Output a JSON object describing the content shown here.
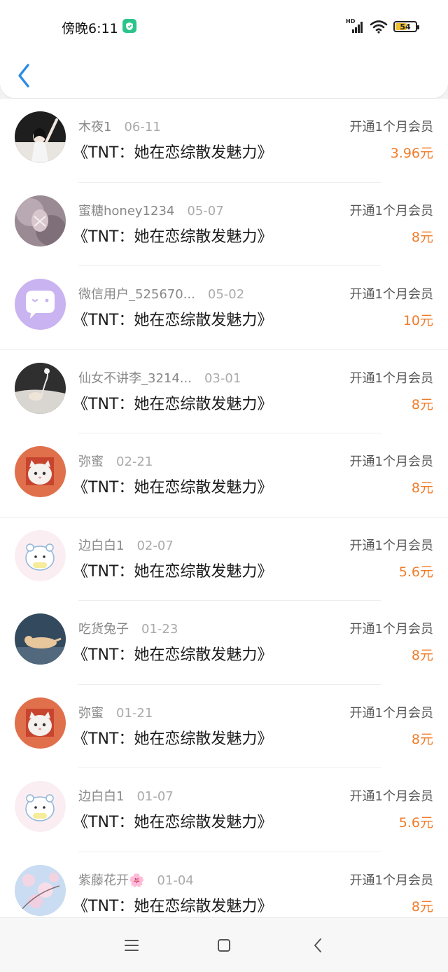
{
  "status_bar": {
    "time": "傍晚6:11",
    "signal_label": "HD",
    "battery": "54",
    "battery_level": 0.54
  },
  "header": {
    "back_icon": "chevron-left-icon"
  },
  "records": [
    {
      "name": "木夜1",
      "date": "06-11",
      "title": "《TNT：她在恋综散发魅力》",
      "label": "开通1个月会员",
      "price": "3.96元"
    },
    {
      "name": "蜜糖honey1234",
      "date": "05-07",
      "title": "《TNT：她在恋综散发魅力》",
      "label": "开通1个月会员",
      "price": "8元"
    },
    {
      "name": "微信用户_525670...",
      "date": "05-02",
      "title": "《TNT：她在恋综散发魅力》",
      "label": "开通1个月会员",
      "price": "10元"
    },
    {
      "name": "仙女不讲李_3214...",
      "date": "03-01",
      "title": "《TNT：她在恋综散发魅力》",
      "label": "开通1个月会员",
      "price": "8元"
    },
    {
      "name": "弥蜜",
      "date": "02-21",
      "title": "《TNT：她在恋综散发魅力》",
      "label": "开通1个月会员",
      "price": "8元"
    },
    {
      "name": "边白白1",
      "date": "02-07",
      "title": "《TNT：她在恋综散发魅力》",
      "label": "开通1个月会员",
      "price": "5.6元"
    },
    {
      "name": "吃货兔子",
      "date": "01-23",
      "title": "《TNT：她在恋综散发魅力》",
      "label": "开通1个月会员",
      "price": "8元"
    },
    {
      "name": "弥蜜",
      "date": "01-21",
      "title": "《TNT：她在恋综散发魅力》",
      "label": "开通1个月会员",
      "price": "8元"
    },
    {
      "name": "边白白1",
      "date": "01-07",
      "title": "《TNT：她在恋综散发魅力》",
      "label": "开通1个月会员",
      "price": "5.6元"
    },
    {
      "name": "紫藤花开🌸",
      "date": "01-04",
      "title": "《TNT：她在恋综散发魅力》",
      "label": "开通1个月会员",
      "price": "8元"
    }
  ],
  "nav": {
    "menu_icon": "menu-icon",
    "home_icon": "home-icon",
    "back_icon": "back-icon"
  },
  "colors": {
    "accent": "#2b8ae6",
    "price": "#f07c2a"
  }
}
